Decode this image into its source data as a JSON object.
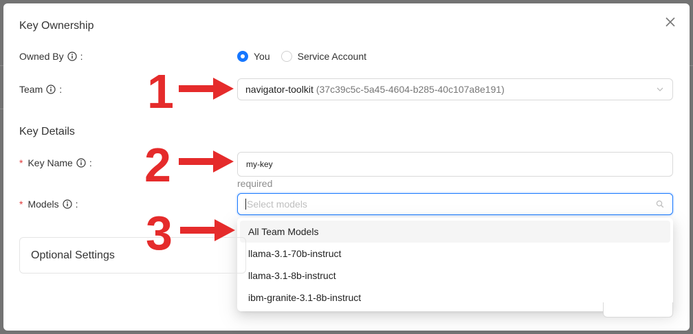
{
  "modal": {
    "key_ownership_title": "Key Ownership",
    "key_details_title": "Key Details",
    "owned_by_label": "Owned By",
    "owned_by_options": [
      "You",
      "Service Account"
    ],
    "owned_by_selected": "You",
    "team_label": "Team",
    "team_value_name": "navigator-toolkit",
    "team_value_id": "(37c39c5c-5a45-4604-b285-40c107a8e191)",
    "key_name_label": "Key Name",
    "key_name_value": "my-key",
    "key_name_hint": "required",
    "models_label": "Models",
    "models_placeholder": "Select models",
    "models_options": [
      "All Team Models",
      "llama-3.1-70b-instruct",
      "llama-3.1-8b-instruct",
      "ibm-granite-3.1-8b-instruct"
    ],
    "optional_settings_label": "Optional Settings",
    "required_marker": "*",
    "label_suffix": ":"
  },
  "annotations": [
    "1",
    "2",
    "3"
  ],
  "colors": {
    "accent": "#1677ff",
    "annotation_red": "#e52b2b",
    "required_red": "#e03a3a"
  },
  "icons": {
    "close": "close-icon",
    "info": "info-icon",
    "chevron": "chevron-down-icon",
    "search": "search-icon"
  }
}
